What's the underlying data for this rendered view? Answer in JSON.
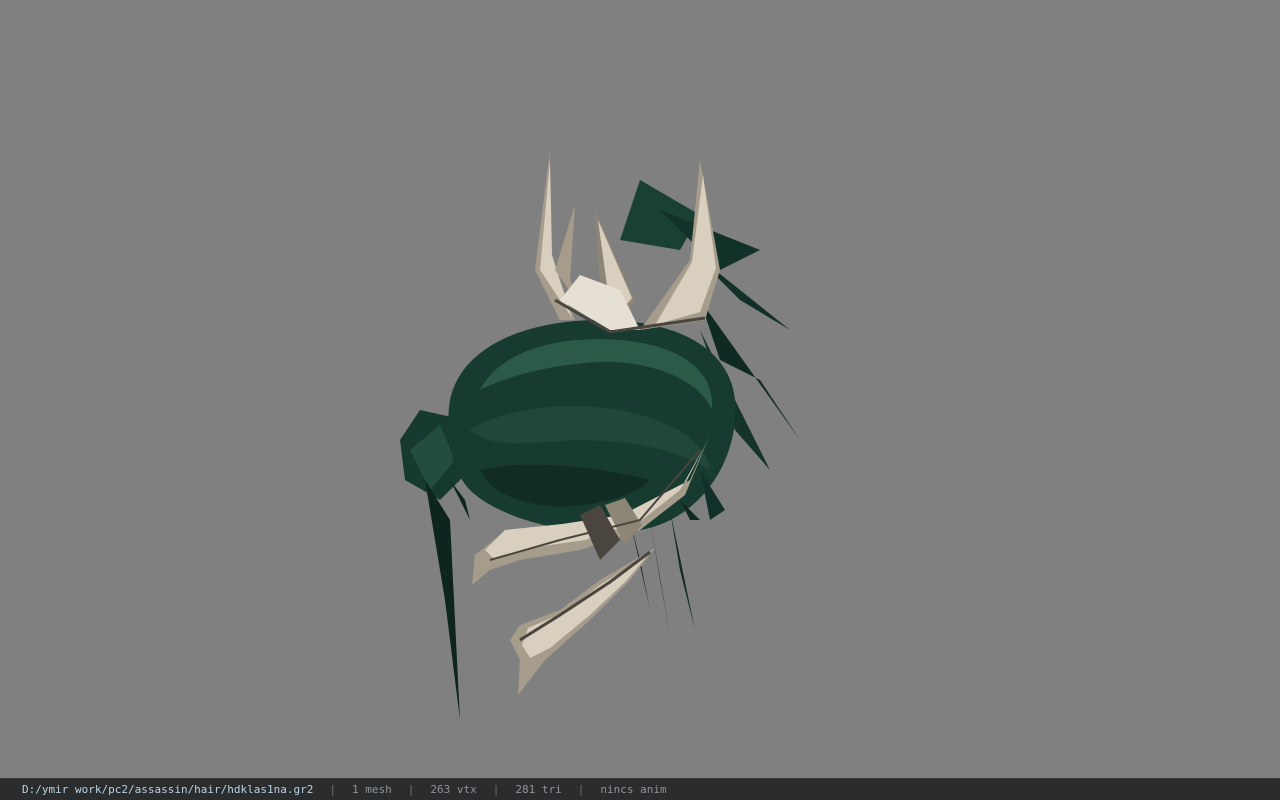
{
  "viewer": {
    "background_color": "#808080",
    "model_name": "hdklas1na.gr2",
    "colors": {
      "hair_dark": "#0f2a22",
      "hair_mid": "#1d4436",
      "hair_light": "#2b5a48",
      "metal_light": "#d8cfbe",
      "metal_mid": "#a59c8b",
      "metal_dark": "#4a463f"
    }
  },
  "status_bar": {
    "file_path": "D:/ymir work/pc2/assassin/hair/hdklas1na.gr2",
    "separator": "|",
    "mesh_count": "1 mesh",
    "vertex_count": "263 vtx",
    "triangle_count": "281 tri",
    "anim_status": "nincs anim"
  }
}
